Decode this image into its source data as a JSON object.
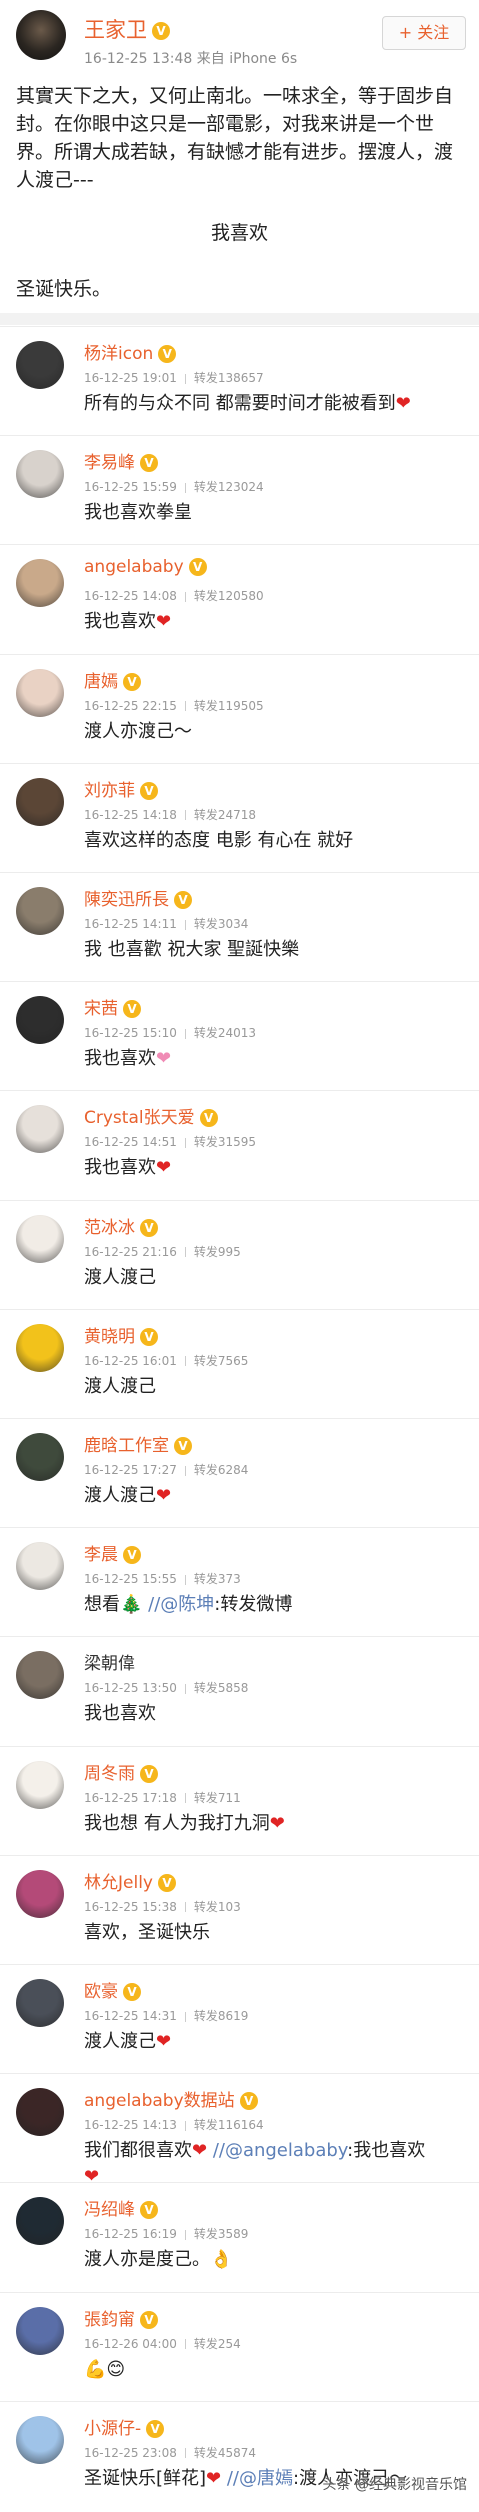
{
  "post": {
    "author": "王家卫",
    "verified_icon": "v-badge-icon",
    "meta": "16-12-25 13:48  来自 iPhone 6s",
    "follow_label": "+ 关注",
    "text": "其實天下之大，又何止南北。一味求全，等于固步自封。在你眼中这只是一部電影，对我来讲是一个世界。所谓大成若缺，有缺憾才能有进步。摆渡人，渡人渡己---",
    "center_line": "我喜欢",
    "closing": "圣诞快乐。"
  },
  "comments": [
    {
      "name": "杨洋icon",
      "time": "16-12-25 19:01",
      "forward": "转发138657",
      "text": "所有的与众不同 都需要时间才能被看到",
      "heart": true,
      "avatar_color": "#3a3a3a"
    },
    {
      "name": "李易峰",
      "time": "16-12-25 15:59",
      "forward": "转发123024",
      "text": "我也喜欢拳皇",
      "avatar_color": "#d8d2cc"
    },
    {
      "name": "angelababy",
      "time": "16-12-25 14:08",
      "forward": "转发120580",
      "text": "我也喜欢",
      "heart": true,
      "avatar_color": "#c9a98a"
    },
    {
      "name": "唐嫣",
      "time": "16-12-25 22:15",
      "forward": "转发119505",
      "text": "渡人亦渡己～",
      "avatar_color": "#e9d2c4"
    },
    {
      "name": "刘亦菲",
      "time": "16-12-25 14:18",
      "forward": "转发24718",
      "text": "喜欢这样的态度 电影 有心在 就好",
      "avatar_color": "#5b4636"
    },
    {
      "name": "陳奕迅所長",
      "time": "16-12-25 14:11",
      "forward": "转发3034",
      "text": "我  也喜歡 祝大家 聖誕快樂",
      "avatar_color": "#8a7d6c"
    },
    {
      "name": "宋茜",
      "time": "16-12-25 15:10",
      "forward": "转发24013",
      "text": "我也喜欢",
      "heart_pink": true,
      "avatar_color": "#2d2d2d"
    },
    {
      "name": "Crystal张天爱",
      "time": "16-12-25 14:51",
      "forward": "转发31595",
      "text": "我也喜欢",
      "heart": true,
      "avatar_color": "#e6e0da"
    },
    {
      "name": "范冰冰",
      "time": "16-12-25 21:16",
      "forward": "转发995",
      "text": "渡人渡己",
      "avatar_color": "#f1ece6"
    },
    {
      "name": "黄晓明",
      "time": "16-12-25 16:01",
      "forward": "转发7565",
      "text": "渡人渡己",
      "avatar_color": "#f2c21b"
    },
    {
      "name": "鹿晗工作室",
      "time": "16-12-25 17:27",
      "forward": "转发6284",
      "text": "渡人渡己",
      "heart": true,
      "avatar_color": "#3f4a3c"
    },
    {
      "name": "李晨",
      "time": "16-12-25 15:55",
      "forward": "转发373",
      "text_before": "想看🎄 ",
      "mention": "//@陈坤",
      "text_after": ":转发微博",
      "avatar_color": "#ece8e2"
    },
    {
      "name": "梁朝偉",
      "plain": true,
      "time": "16-12-25 13:50",
      "forward": "转发5858",
      "text": "我也喜欢",
      "avatar_color": "#7a6e62"
    },
    {
      "name": "周冬雨",
      "time": "16-12-25 17:18",
      "forward": "转发711",
      "text": "我也想 有人为我打九洞",
      "heart": true,
      "avatar_color": "#f4f0ea"
    },
    {
      "name": "林允Jelly",
      "time": "16-12-25 15:38",
      "forward": "转发103",
      "text": "喜欢，圣诞快乐",
      "avatar_color": "#b44a78"
    },
    {
      "name": "欧豪",
      "time": "16-12-25 14:31",
      "forward": "转发8619",
      "text": "渡人渡己",
      "heart": true,
      "avatar_color": "#4a4f58"
    },
    {
      "name": "angelababy数据站",
      "time": "16-12-25 14:13",
      "forward": "转发116164",
      "text_before": "我们都很喜欢",
      "heart_mid": true,
      "mention": " //@angelababy",
      "text_after": ":我也喜欢",
      "trail_heart": true,
      "avatar_color": "#3b2626"
    },
    {
      "name": "冯绍峰",
      "time": "16-12-25 16:19",
      "forward": "转发3589",
      "text": "渡人亦是度己。👌",
      "avatar_color": "#1f2a33"
    },
    {
      "name": "張鈞甯",
      "time": "16-12-26 04:00",
      "forward": "转发254",
      "text": "💪😊",
      "avatar_color": "#5a6ea8"
    },
    {
      "name": "小源仔-",
      "time": "16-12-25 23:08",
      "forward": "转发45874",
      "text_before": "圣诞快乐[鲜花]",
      "heart_mid": true,
      "mention": " //@唐嫣",
      "text_after": ":渡人亦渡己～",
      "avatar_color": "#9fc3e8"
    }
  ],
  "watermark": "头条 @经典影视音乐馆"
}
